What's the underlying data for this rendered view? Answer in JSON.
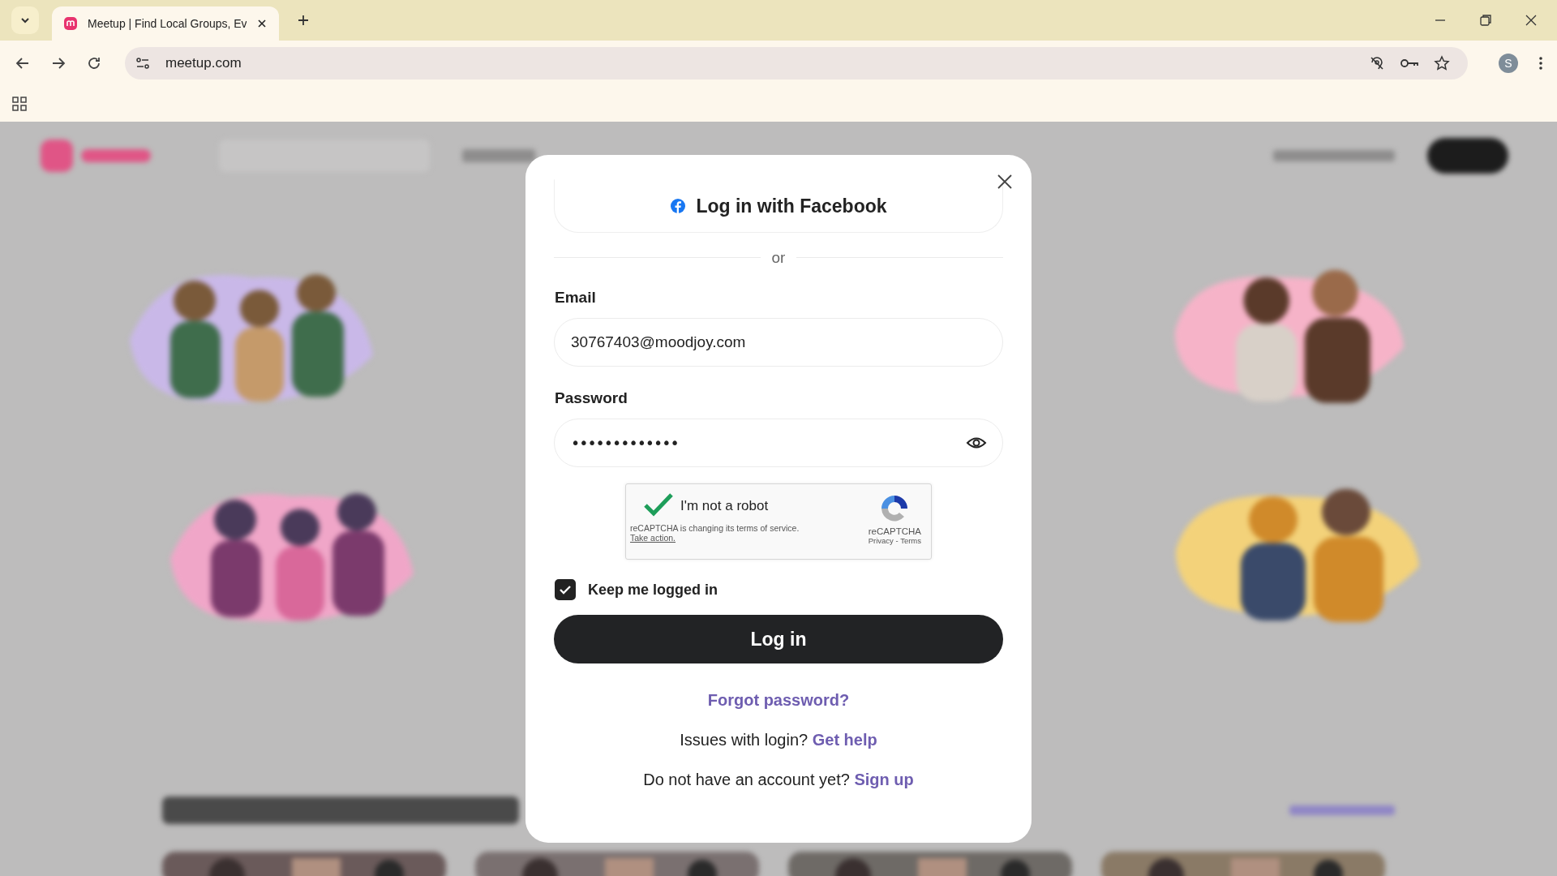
{
  "browser": {
    "tabs": [
      {
        "title": "Meetup | Find Local Groups, Ev",
        "selected": true
      }
    ],
    "address": "meetup.com",
    "profile_initial": "S"
  },
  "login_dialog": {
    "facebook_button": "Log in with Facebook",
    "divider": "or",
    "email": {
      "label": "Email",
      "value": "30767403@moodjoy.com"
    },
    "password": {
      "label": "Password",
      "value": "•••••••••••••"
    },
    "recaptcha": {
      "checked": true,
      "label": "I'm not a robot",
      "notice": "reCAPTCHA is changing its terms of service.",
      "notice_link": "Take action.",
      "brand": "reCAPTCHA",
      "links": "Privacy - Terms"
    },
    "keep_logged_in": {
      "label": "Keep me logged in",
      "checked": true
    },
    "login_button": "Log in",
    "forgot_link": "Forgot password?",
    "help": {
      "text": "Issues with login?",
      "link": "Get help"
    },
    "signup": {
      "text": "Do not have an account yet?",
      "link": "Sign up"
    }
  }
}
